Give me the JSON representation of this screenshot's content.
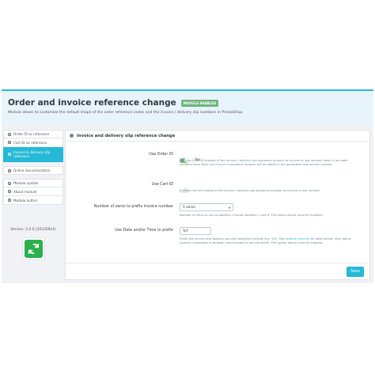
{
  "header": {
    "title": "Order and invoice reference change",
    "badge": "MODULE ENABLED",
    "subtitle": "Module allows to customize the default shape of the order reference codes and the invoice / delivery slip numbers in PrestaShop."
  },
  "sidebar": {
    "items": [
      {
        "label": "Order ID as reference",
        "icon": "circle-icon"
      },
      {
        "label": "Cart ID as reference",
        "icon": "circle-icon"
      },
      {
        "label": "Invoice & delivery slip reference",
        "icon": "circle-icon"
      }
    ],
    "links": [
      {
        "label": "Online documentation",
        "icon": "document-icon"
      }
    ],
    "extras": [
      {
        "label": "Module update",
        "icon": "refresh-icon"
      },
      {
        "label": "About module",
        "icon": "info-icon"
      },
      {
        "label": "Module author",
        "icon": "user-icon"
      }
    ],
    "version": "Version: 2.0.0 (20230914)"
  },
  "content": {
    "heading": "Invoice and delivery slip reference change",
    "fields": [
      {
        "label": "Use Order ID",
        "toggle_text": "Yes",
        "help": "Use the Order ID instead of the invoice / delivery slip sequence number as invoice or slip number. Note: if an order contains more than one invoice a sequence number will be added in the generated new invoice number."
      },
      {
        "label": "Use Cart ID",
        "help": "Use the Cart ID instead of the invoice / delivery slip sequence number as invoice or slip number."
      },
      {
        "label": "Number of zeros to prefix invoice number",
        "select_value": "5 zeros",
        "help": "Number of zeros to use as padding. Choose between 1 and 9. The option above must be enabled."
      },
      {
        "label": "Use Date and/or Time to prefix",
        "input_value": "%Y",
        "help_pre": "Prefix the invoice and delivery slip with date/time format (e.g. %Y). See",
        "help_link": "strftime function",
        "help_post": "for date format. Only alpha-numeric characters is allowed. Leave empty to not use prefix. The option above must be enabled."
      }
    ],
    "save_label": "Save"
  },
  "colors": {
    "accent": "#25b9d7",
    "success": "#70b580",
    "logo": "#2bb14c"
  }
}
